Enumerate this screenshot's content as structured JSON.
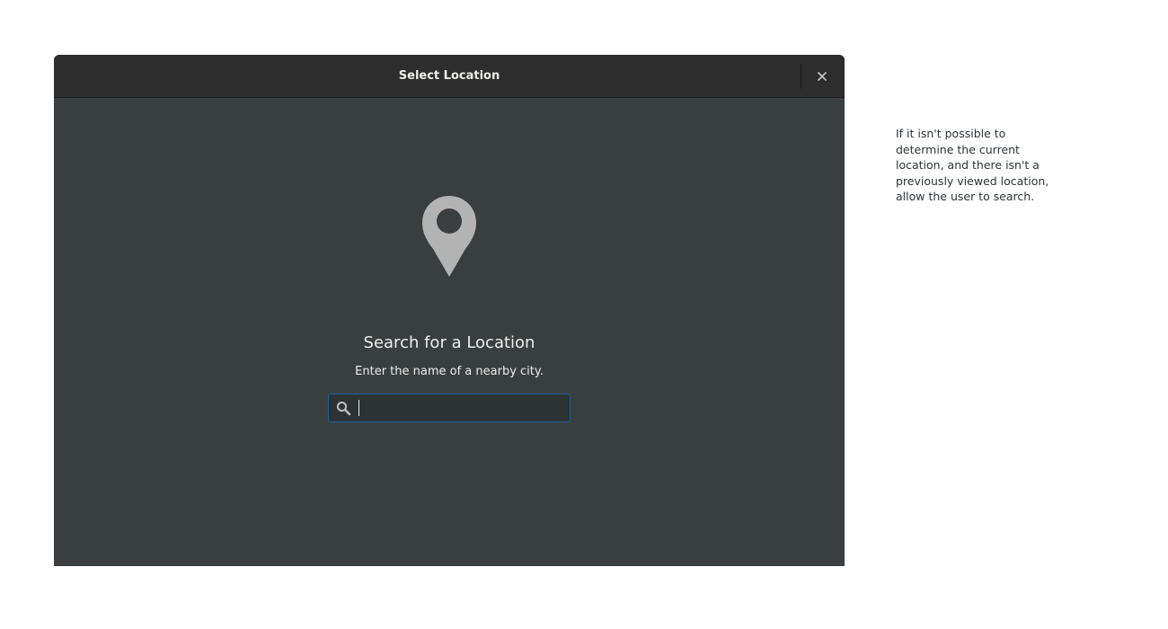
{
  "dialog": {
    "title": "Select Location",
    "close_label": "×",
    "empty_state": {
      "icon": "map-pin-icon",
      "heading": "Search for a Location",
      "subtitle": "Enter the name of a nearby city."
    },
    "search": {
      "icon": "search-icon",
      "value": "",
      "placeholder": ""
    }
  },
  "annotation": {
    "text": "If it isn't possible to determine the current location, and there isn't a previously viewed location, allow the user to search."
  },
  "colors": {
    "window_bg": "#393f3f",
    "headerbar_bg": "#2d2d2d",
    "text_light": "#eeeeec",
    "pin_gray": "#b3b3b3",
    "entry_focus_border": "#215d9c"
  }
}
